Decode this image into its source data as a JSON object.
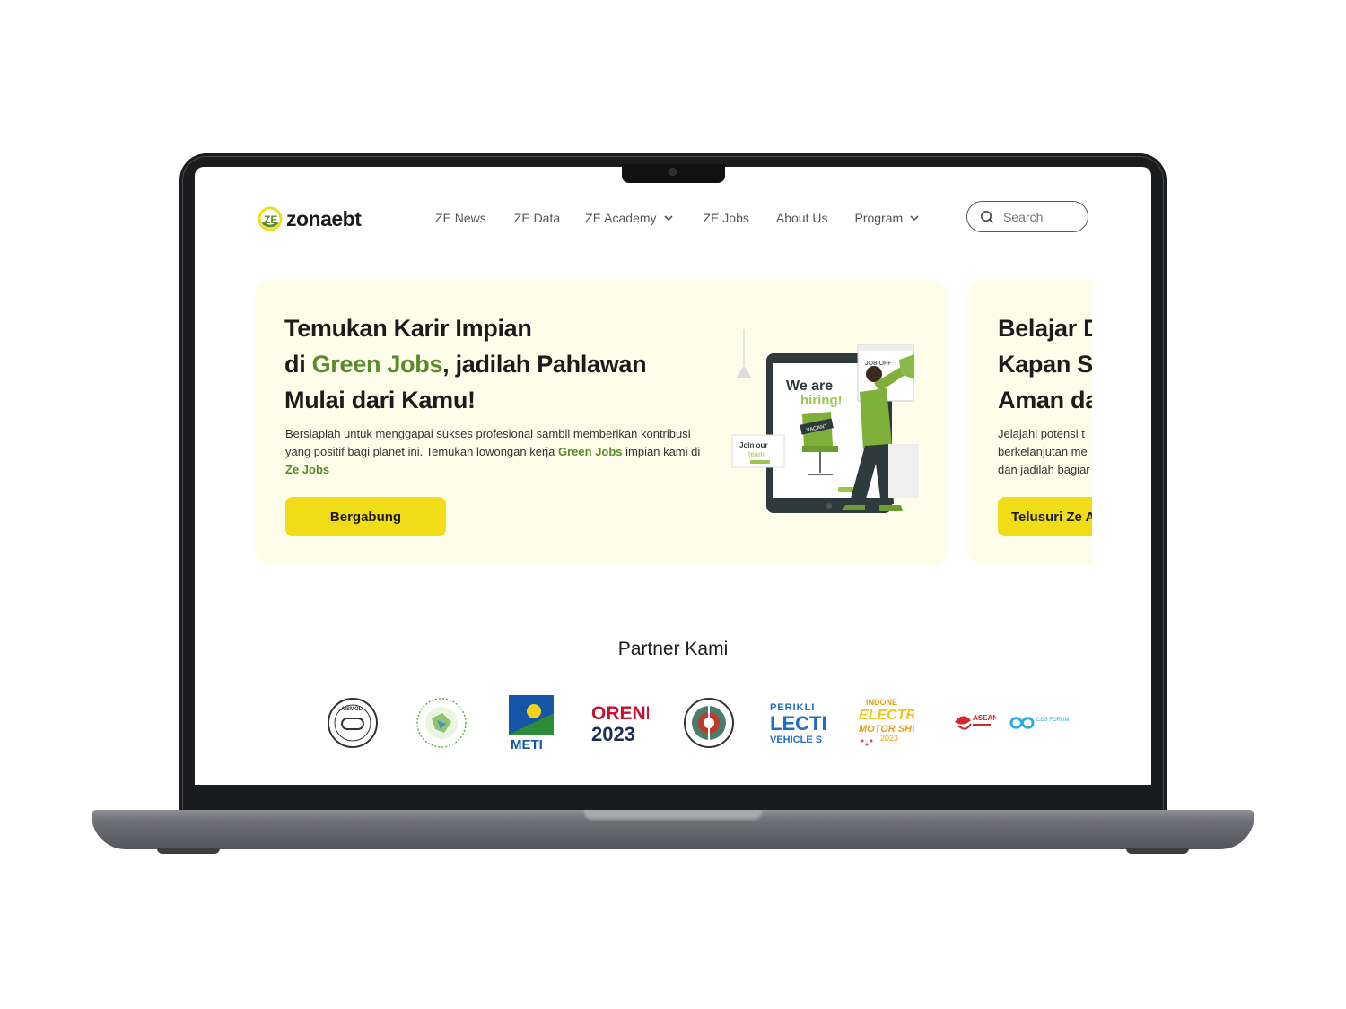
{
  "brand": {
    "name": "zonaebt"
  },
  "nav": {
    "items": [
      {
        "label": "ZE News",
        "dropdown": false
      },
      {
        "label": "ZE Data",
        "dropdown": false
      },
      {
        "label": "ZE Academy",
        "dropdown": true
      },
      {
        "label": "ZE Jobs",
        "dropdown": false
      },
      {
        "label": "About Us",
        "dropdown": false
      },
      {
        "label": "Program",
        "dropdown": true
      }
    ]
  },
  "search": {
    "placeholder": "Search"
  },
  "hero": {
    "card1": {
      "title_line1": "Temukan Karir Impian",
      "title_line2_pre": "di ",
      "title_line2_highlight": "Green Jobs",
      "title_line2_post": ", jadilah Pahlawan",
      "title_line3": "Mulai dari Kamu!",
      "desc_part1": "Bersiaplah untuk menggapai sukses profesional sambil memberikan kontribusi yang positif bagi planet ini. Temukan lowongan kerja ",
      "desc_highlight1": "Green Jobs",
      "desc_part2": " impian kami di ",
      "desc_highlight2": "Ze Jobs",
      "button": "Bergabung",
      "illustration": {
        "tag_job": "JOB OFF",
        "hiring_line1": "We are",
        "hiring_line2": "hiring!",
        "vacant": "VACANT",
        "join_line1": "Join our",
        "join_line2": "team"
      }
    },
    "card2": {
      "title_line1": "Belajar D",
      "title_line2": "Kapan S",
      "title_line3": "Aman da",
      "desc_line1": "Jelajahi potensi t",
      "desc_line2": "berkelanjutan me",
      "desc_line3": "dan jadilah bagiar",
      "button": "Telusuri Ze A"
    }
  },
  "partners": {
    "title": "Partner Kami",
    "logos": [
      {
        "name": "AISMOLI",
        "text": "AISMOLI"
      },
      {
        "name": "Green seal",
        "text": ""
      },
      {
        "name": "METI",
        "text": "METI"
      },
      {
        "name": "ORENE 2023",
        "text": "ORENE",
        "text2": "2023"
      },
      {
        "name": "Round emblem",
        "text": ""
      },
      {
        "name": "PERIKLINDO Electric Vehicle Show",
        "text": "PERIKLI",
        "text2": "LECTI",
        "text3": "VEHICLE S"
      },
      {
        "name": "Indonesia Electric Motor Show 2023",
        "text": "INDONE",
        "text2": "ELECTR",
        "text3": "MOTOR SHO",
        "text4": "2023"
      },
      {
        "name": "ASEAN Indonesia 2023",
        "text": "ASEAN"
      },
      {
        "name": "CDS Forum",
        "text": "CDS FORUM"
      }
    ]
  },
  "colors": {
    "accent_yellow": "#f0dc17",
    "green": "#5b8a2d",
    "card_bg": "#fdfde9"
  }
}
